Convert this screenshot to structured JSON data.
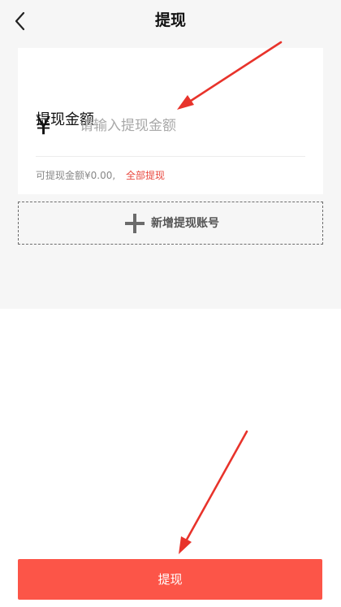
{
  "header": {
    "back_icon": "chevron-left-icon",
    "title": "提现"
  },
  "amount_card": {
    "title": "提现金额",
    "currency_symbol": "¥",
    "input_value": "",
    "input_placeholder": "请输入提现金额",
    "available_text": "可提现金额¥0.00,",
    "withdraw_all_label": "全部提现"
  },
  "add_account": {
    "icon": "plus-icon",
    "label": "新增提现账号"
  },
  "submit": {
    "label": "提现"
  },
  "colors": {
    "accent": "#fc5548",
    "link": "#e9483f",
    "annotation_arrow": "#e8332b",
    "page_bg": "#f6f6f6"
  }
}
